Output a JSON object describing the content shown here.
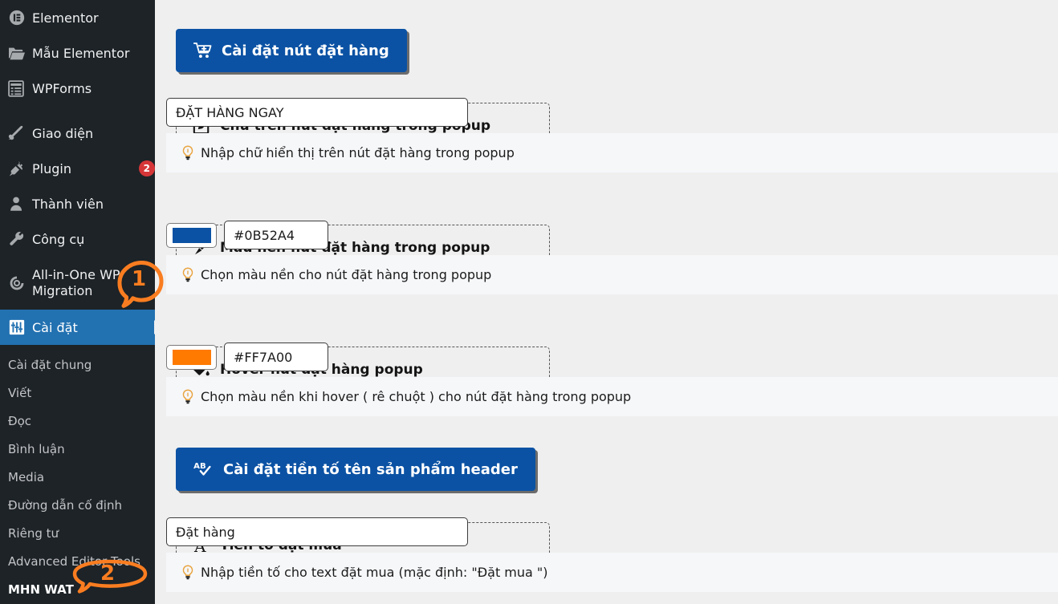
{
  "colors": {
    "sidebar_bg": "#1d2327",
    "active_menu_bg": "#2271b1",
    "content_bg": "#efefef",
    "section_button_bg": "#0b52a4",
    "hint_bg": "#f6f7f9",
    "badge_bg": "#d63638",
    "marker_orange": "#f97d20",
    "order_button_color": "#0B52A4",
    "order_button_hover_color": "#FF7A00"
  },
  "sidebar": {
    "items": [
      {
        "label": "Elementor",
        "icon": "elementor-icon",
        "badge": null
      },
      {
        "label": "Mẫu Elementor",
        "icon": "folder-icon",
        "badge": null
      },
      {
        "label": "WPForms",
        "icon": "wpforms-icon",
        "badge": null
      },
      {
        "label": "Giao diện",
        "icon": "appearance-brush-icon",
        "badge": null
      },
      {
        "label": "Plugin",
        "icon": "plugin-icon",
        "badge": "2"
      },
      {
        "label": "Thành viên",
        "icon": "users-icon",
        "badge": null
      },
      {
        "label": "Công cụ",
        "icon": "tools-wrench-icon",
        "badge": null
      },
      {
        "label": "All-in-One WP Migration",
        "icon": "migration-icon",
        "badge": null
      },
      {
        "label": "Cài đặt",
        "icon": "settings-sliders-icon",
        "badge": null,
        "active": true
      }
    ],
    "submenu": [
      {
        "label": "Cài đặt chung",
        "current": false
      },
      {
        "label": "Viết",
        "current": false
      },
      {
        "label": "Đọc",
        "current": false
      },
      {
        "label": "Bình luận",
        "current": false
      },
      {
        "label": "Media",
        "current": false
      },
      {
        "label": "Đường dẫn cố định",
        "current": false
      },
      {
        "label": "Riêng tư",
        "current": false
      },
      {
        "label": "Advanced Editor Tools",
        "current": false
      },
      {
        "label": "MHN WAT",
        "current": true
      }
    ]
  },
  "markers": [
    {
      "number": "1",
      "shape": "circle-speech-bubble"
    },
    {
      "number": "2",
      "shape": "ellipse-speech-bubble"
    }
  ],
  "main": {
    "sections": [
      {
        "heading": "Cài đặt nút đặt hàng",
        "heading_icon": "cart-plus-icon"
      },
      {
        "heading": "Cài đặt tiền tố tên sản phẩm header",
        "heading_icon": "spellcheck-ab-icon"
      }
    ],
    "fields": [
      {
        "label": "Chữ trên nút đặt hàng trong popup",
        "label_icon": "pencil-square-icon",
        "type": "text",
        "value": "ĐẶT HÀNG NGAY",
        "placeholder": "",
        "hint": "Nhập chữ hiển thị trên nút đặt hàng trong popup",
        "hint_icon": "lightbulb-icon"
      },
      {
        "label": "Màu nền nút đặt hàng trong popup",
        "label_icon": "paint-brush-icon",
        "type": "color",
        "value": "#0B52A4",
        "swatch": "#0B52A4",
        "hint": "Chọn màu nền cho nút đặt hàng trong popup",
        "hint_icon": "lightbulb-icon"
      },
      {
        "label": "Hover nút đặt hàng popup",
        "label_icon": "paint-bucket-icon",
        "type": "color",
        "value": "#FF7A00",
        "swatch": "#FF7A00",
        "hint": "Chọn màu nền khi hover ( rê chuột ) cho nút đặt hàng trong popup",
        "hint_icon": "lightbulb-icon"
      },
      {
        "label": "Tiền tố đặt mua",
        "label_icon": "letter-a-icon",
        "type": "text",
        "value": "Đặt hàng",
        "placeholder": "",
        "hint": "Nhập tiền tố cho text đặt mua (mặc định: \"Đặt mua \")",
        "hint_icon": "lightbulb-icon"
      }
    ]
  }
}
